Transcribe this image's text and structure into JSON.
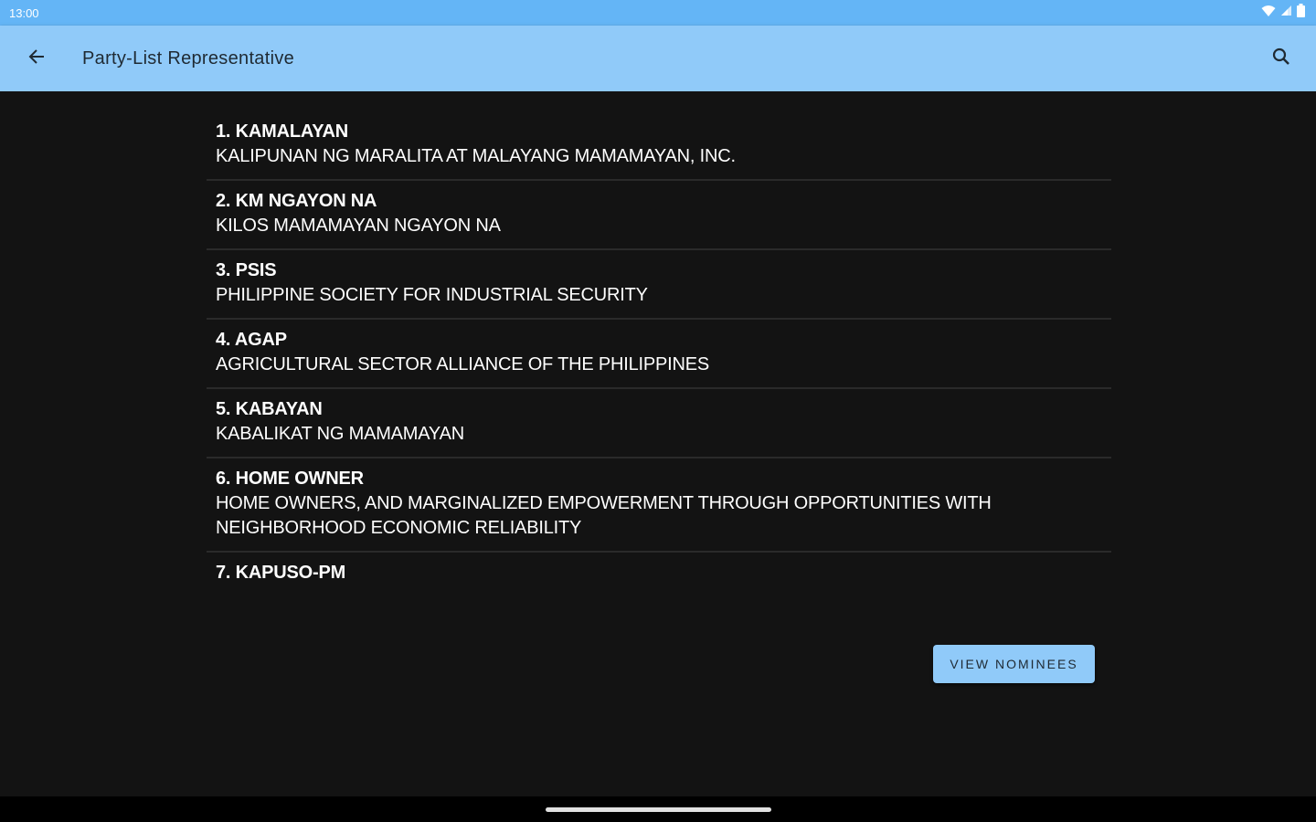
{
  "status_bar": {
    "time": "13:00",
    "icons": [
      "wifi-icon",
      "signal-icon",
      "battery-icon"
    ]
  },
  "app_bar": {
    "title": "Party-List Representative",
    "back_icon": "arrow-left-icon",
    "search_icon": "search-icon"
  },
  "parties": [
    {
      "name": "1. KAMALAYAN",
      "full_name": "KALIPUNAN NG MARALITA AT MALAYANG MAMAMAYAN, INC."
    },
    {
      "name": "2. KM NGAYON NA",
      "full_name": "KILOS MAMAMAYAN NGAYON NA"
    },
    {
      "name": "3. PSIS",
      "full_name": "PHILIPPINE SOCIETY FOR INDUSTRIAL SECURITY"
    },
    {
      "name": "4. AGAP",
      "full_name": "AGRICULTURAL SECTOR ALLIANCE OF THE PHILIPPINES"
    },
    {
      "name": "5. KABAYAN",
      "full_name": "KABALIKAT NG MAMAMAYAN"
    },
    {
      "name": "6. HOME OWNER",
      "full_name": "HOME OWNERS, AND MARGINALIZED EMPOWERMENT THROUGH OPPORTUNITIES WITH NEIGHBORHOOD ECONOMIC RELIABILITY"
    },
    {
      "name": "7. KAPUSO-PM",
      "full_name": ""
    }
  ],
  "view_nominees_label": "VIEW NOMINEES",
  "colors": {
    "status_bar": "#64b5f6",
    "app_bar": "#90caf9",
    "background": "#131313",
    "button": "#90caf9"
  }
}
